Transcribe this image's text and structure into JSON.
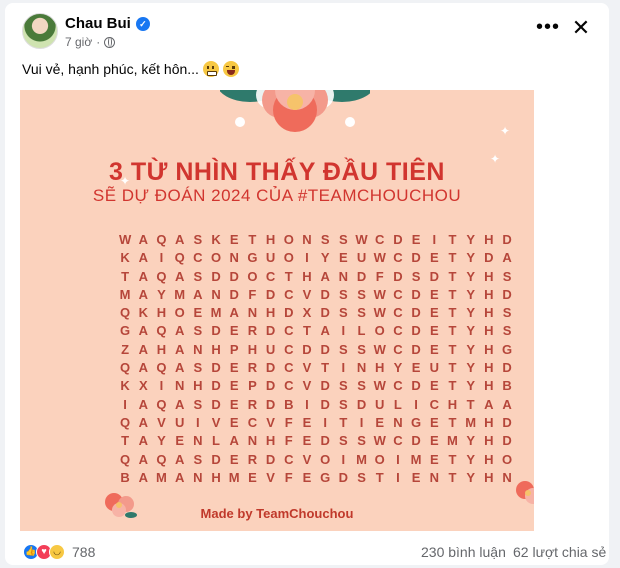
{
  "post": {
    "author": "Chau Bui",
    "time": "7 giờ",
    "text": "Vui vẻ, hạnh phúc, kết hôn..."
  },
  "icons": {
    "verified": "verified-badge-icon",
    "audience": "globe-icon",
    "more": "more-options-icon",
    "close": "close-icon"
  },
  "image": {
    "title": "3 TỪ NHÌN THẤY ĐẦU TIÊN",
    "subtitle": "SẼ DỰ ĐOÁN 2024 CỦA #TEAMCHOUCHOU",
    "grid_rows": [
      "WAQASKETHONSSWCDEITYHD",
      "KAIQCONGUOIYEUWCDETYDA",
      "TAQASDDOCTHANDFDSDTYHS",
      "MAYMANDFDCVDSSWCDETYHD",
      "QKHOEMANHDXDSSWCDETYHS",
      "GAQASDERDCTAILOCDETYHS",
      "ZAHANHPHUCDDSSWCDETYHG",
      "QAQASDERDCVTINHYEUTYHD",
      "KXINHDEPDCVDSSWCDETYHB",
      "IAQASDERDBIDSDULICHTAA",
      "QAVUIVECVFEITIENGETMHD",
      "TAYENLANHFEDSSWCDEMYHD",
      "QAQASDERDCVOIMOIMETYHO",
      "BAMANHMEVFEGDSTIENTYHN"
    ],
    "made_by": "Made by TeamChouchou"
  },
  "footer": {
    "reaction_count": "788",
    "comments": "230 bình luận",
    "shares": "62 lượt chia sẻ"
  },
  "colors": {
    "poster_bg": "#fbd2bd",
    "accent_red": "#d1352f",
    "grid_letters": "#b6463a",
    "facebook_blue": "#1877f2"
  }
}
